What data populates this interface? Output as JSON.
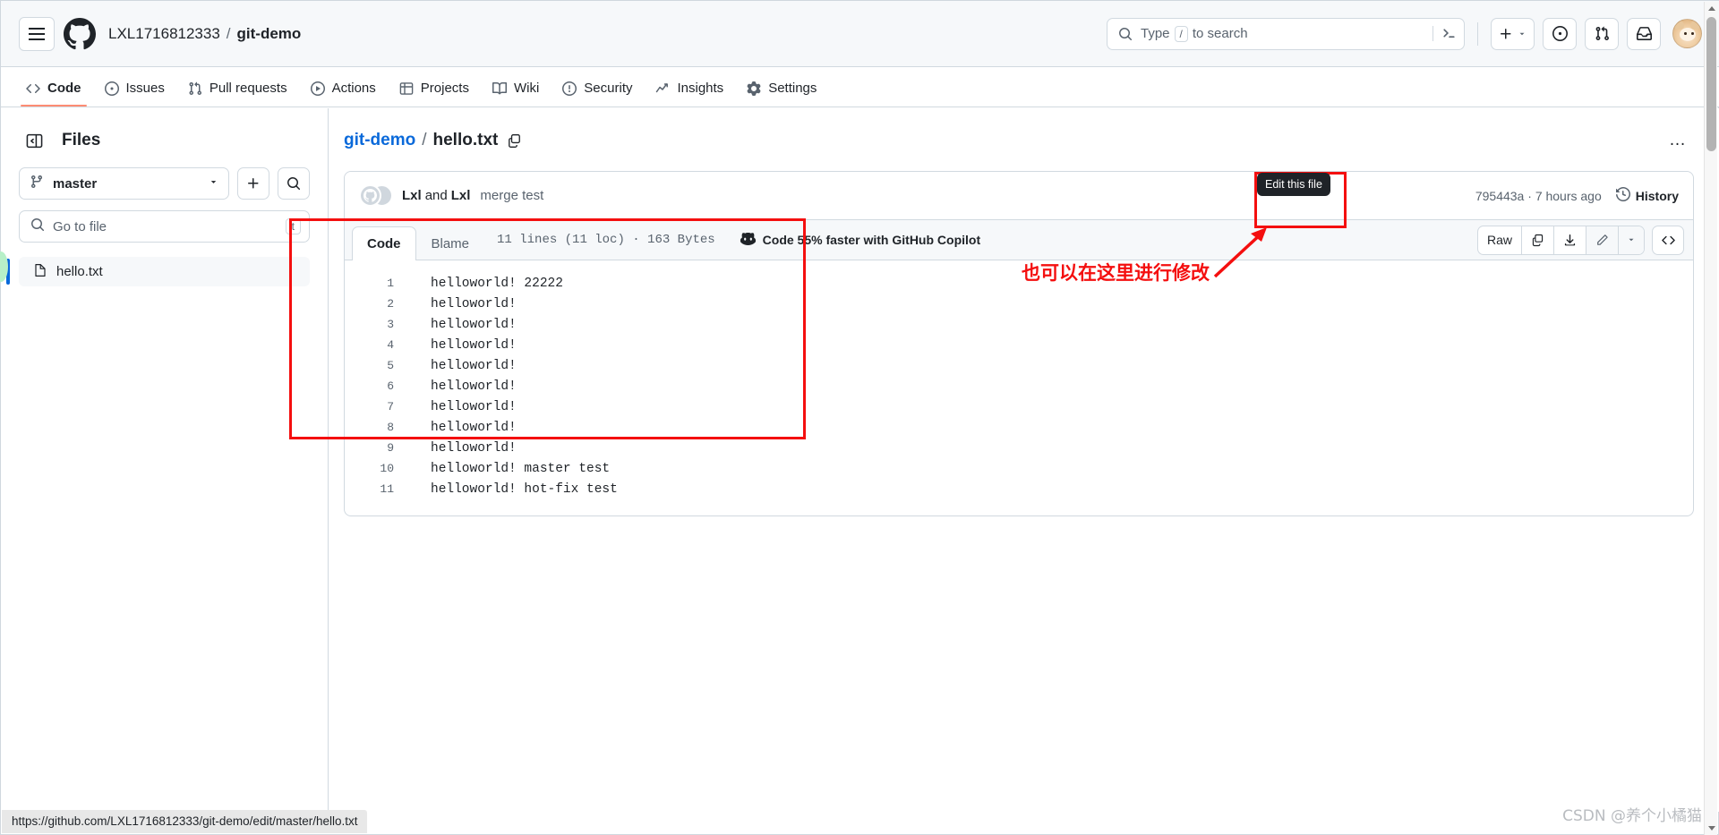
{
  "header": {
    "menu_icon": "hamburger-icon",
    "logo_icon": "github-mark-icon",
    "owner": "LXL1716812333",
    "separator": "/",
    "repo": "git-demo",
    "search": {
      "placeholder": "Type",
      "key_hint": "/",
      "placeholder_suffix": "to search",
      "terminal_icon": "command-palette-icon"
    },
    "actions": {
      "create_new": "plus-icon",
      "create_caret": "chevron-down-icon",
      "issues": "issue-opened-icon",
      "pull_requests": "git-pull-request-icon",
      "notifications": "inbox-icon",
      "avatar": "user-avatar"
    }
  },
  "repo_nav": {
    "items": [
      {
        "label": "Code",
        "icon": "code-icon",
        "active": true
      },
      {
        "label": "Issues",
        "icon": "issue-opened-icon",
        "active": false
      },
      {
        "label": "Pull requests",
        "icon": "git-pull-request-icon",
        "active": false
      },
      {
        "label": "Actions",
        "icon": "play-icon",
        "active": false
      },
      {
        "label": "Projects",
        "icon": "table-icon",
        "active": false
      },
      {
        "label": "Wiki",
        "icon": "book-icon",
        "active": false
      },
      {
        "label": "Security",
        "icon": "shield-icon",
        "active": false
      },
      {
        "label": "Insights",
        "icon": "graph-icon",
        "active": false
      },
      {
        "label": "Settings",
        "icon": "gear-icon",
        "active": false
      }
    ]
  },
  "sidebar": {
    "toggle_icon": "sidebar-collapse-icon",
    "title": "Files",
    "branch": {
      "icon": "git-branch-icon",
      "name": "master",
      "caret": "chevron-down-icon"
    },
    "add_button": "plus-icon",
    "search_button": "search-icon",
    "file_search": {
      "icon": "search-icon",
      "placeholder": "Go to file",
      "key_hint": "t"
    },
    "files": [
      {
        "name": "hello.txt",
        "icon": "file-icon",
        "selected": true
      }
    ]
  },
  "main": {
    "breadcrumb": {
      "repo": "git-demo",
      "separator": "/",
      "file": "hello.txt",
      "copy_icon": "copy-path-icon"
    },
    "more_menu": "…",
    "commit": {
      "author": "Lxl",
      "and_text": "and",
      "coauthor": "Lxl",
      "message": "merge test",
      "sha": "795443a",
      "meta_sep": "·",
      "time": "7 hours ago",
      "history_label": "History",
      "history_icon": "history-clock-icon"
    },
    "toolbar": {
      "tabs": [
        {
          "label": "Code",
          "active": true
        },
        {
          "label": "Blame",
          "active": false
        }
      ],
      "file_meta": "11 lines (11 loc) · 163 Bytes",
      "copilot_text": "Code 55% faster with GitHub Copilot",
      "copilot_icon": "copilot-icon",
      "raw_label": "Raw",
      "copy_icon": "copy-raw-icon",
      "download_icon": "download-icon",
      "edit_icon": "pencil-icon",
      "edit_caret": "chevron-down-icon",
      "symbols_icon": "code-symbols-icon"
    },
    "code": {
      "lines": [
        {
          "n": "1",
          "text": "helloworld! 22222"
        },
        {
          "n": "2",
          "text": "helloworld!"
        },
        {
          "n": "3",
          "text": "helloworld!"
        },
        {
          "n": "4",
          "text": "helloworld!"
        },
        {
          "n": "5",
          "text": "helloworld!"
        },
        {
          "n": "6",
          "text": "helloworld!"
        },
        {
          "n": "7",
          "text": "helloworld!"
        },
        {
          "n": "8",
          "text": "helloworld!"
        },
        {
          "n": "9",
          "text": "helloworld!"
        },
        {
          "n": "10",
          "text": "helloworld! master test"
        },
        {
          "n": "11",
          "text": "helloworld! hot-fix test"
        }
      ]
    }
  },
  "tooltip": {
    "text": "Edit this file"
  },
  "annotation": {
    "text": "也可以在这里进行修改",
    "color": "#f40f0f"
  },
  "status_bar": {
    "url": "https://github.com/LXL1716812333/git-demo/edit/master/hello.txt"
  },
  "watermark": {
    "text": "CSDN @养个小橘猫"
  },
  "colors": {
    "accent_blue": "#0969da",
    "active_tab_underline": "#fd8c73",
    "annotation_red": "#f40f0f",
    "header_bg": "#f6f8fa",
    "border": "#d1d9e0"
  }
}
